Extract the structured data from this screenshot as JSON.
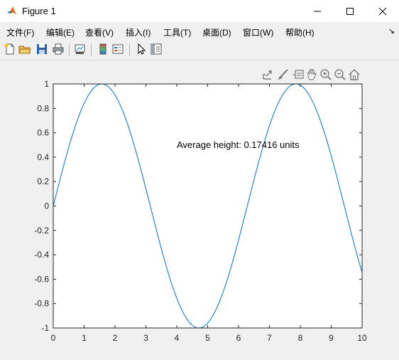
{
  "window": {
    "title": "Figure 1",
    "controls": [
      "minimize",
      "maximize",
      "close"
    ]
  },
  "menu": {
    "items": [
      "文件(F)",
      "编辑(E)",
      "查看(V)",
      "插入(I)",
      "工具(T)",
      "桌面(D)",
      "窗口(W)",
      "帮助(H)"
    ],
    "overflow_arrow": "↘"
  },
  "toolbar": {
    "icons": [
      "new-figure-icon",
      "open-file-icon",
      "save-icon",
      "print-icon",
      "link-plot-icon",
      "colorbar-icon",
      "legend-icon",
      "pointer-icon",
      "property-inspector-icon"
    ]
  },
  "axes_toolbar": {
    "icons": [
      "export-icon",
      "brush-icon",
      "data-tips-icon",
      "pan-icon",
      "zoom-in-icon",
      "zoom-out-icon",
      "home-icon"
    ]
  },
  "colors": {
    "line": "#0072bd",
    "axes_bg": "#ffffff",
    "figure_bg": "#f0f0f0"
  },
  "chart_data": {
    "type": "line",
    "function": "sin(x)",
    "series": [
      {
        "x_start": 0,
        "x_end": 10
      }
    ],
    "xlim": [
      0,
      10
    ],
    "ylim": [
      -1,
      1
    ],
    "xticks": [
      "0",
      "1",
      "2",
      "3",
      "4",
      "5",
      "6",
      "7",
      "8",
      "9",
      "10"
    ],
    "yticks": [
      "1",
      "0.8",
      "0.6",
      "0.4",
      "0.2",
      "0",
      "-0.2",
      "-0.4",
      "-0.6",
      "-0.8",
      "-1"
    ],
    "annotation": {
      "text": "Average height: 0.17416 units",
      "x": 4,
      "y": 0.5
    },
    "grid": false
  }
}
